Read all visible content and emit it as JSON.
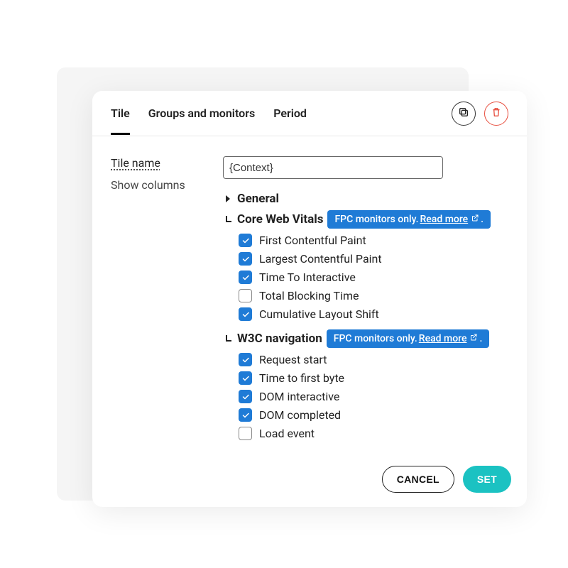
{
  "tabs": {
    "tile": "Tile",
    "groups": "Groups and monitors",
    "period": "Period"
  },
  "labels": {
    "tile_name": "Tile name",
    "show_columns": "Show columns"
  },
  "tile_name_value": "{Context}",
  "groups": {
    "general": "General",
    "cwv": {
      "title": "Core Web Vitals",
      "badge_prefix": "FPC monitors only. ",
      "badge_link": "Read more",
      "items": [
        {
          "label": "First Contentful Paint",
          "checked": true
        },
        {
          "label": "Largest Contentful Paint",
          "checked": true
        },
        {
          "label": "Time To Interactive",
          "checked": true
        },
        {
          "label": "Total Blocking Time",
          "checked": false
        },
        {
          "label": "Cumulative Layout Shift",
          "checked": true
        }
      ]
    },
    "w3c": {
      "title": "W3C navigation",
      "badge_prefix": "FPC monitors only. ",
      "badge_link": "Read more",
      "items": [
        {
          "label": "Request start",
          "checked": true
        },
        {
          "label": "Time to first byte",
          "checked": true
        },
        {
          "label": "DOM interactive",
          "checked": true
        },
        {
          "label": "DOM completed",
          "checked": true
        },
        {
          "label": "Load event",
          "checked": false
        }
      ]
    }
  },
  "footer": {
    "cancel": "CANCEL",
    "set": "SET"
  }
}
